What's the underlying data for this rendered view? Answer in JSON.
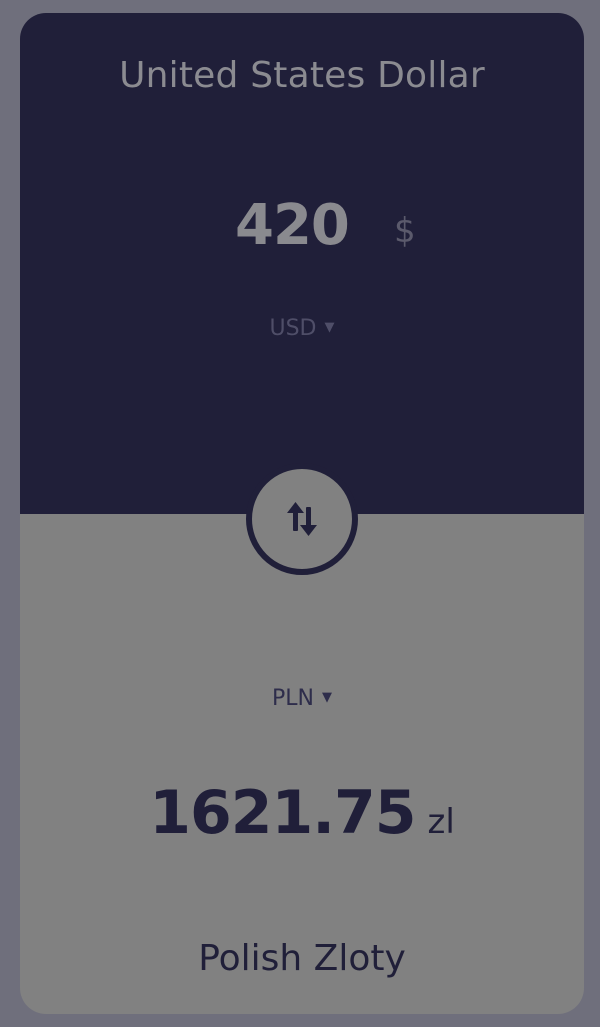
{
  "from": {
    "name": "United States Dollar",
    "amount": "420",
    "symbol": "$",
    "code": "USD"
  },
  "to": {
    "name": "Polish Zloty",
    "amount": "1621.75",
    "symbol": "zl",
    "code": "PLN"
  },
  "icons": {
    "caret": "▼",
    "swap": "swap-vertical-arrows"
  },
  "colors": {
    "background": "#6f6f7c",
    "top_panel": "#201f39",
    "bottom_panel": "#818181"
  }
}
